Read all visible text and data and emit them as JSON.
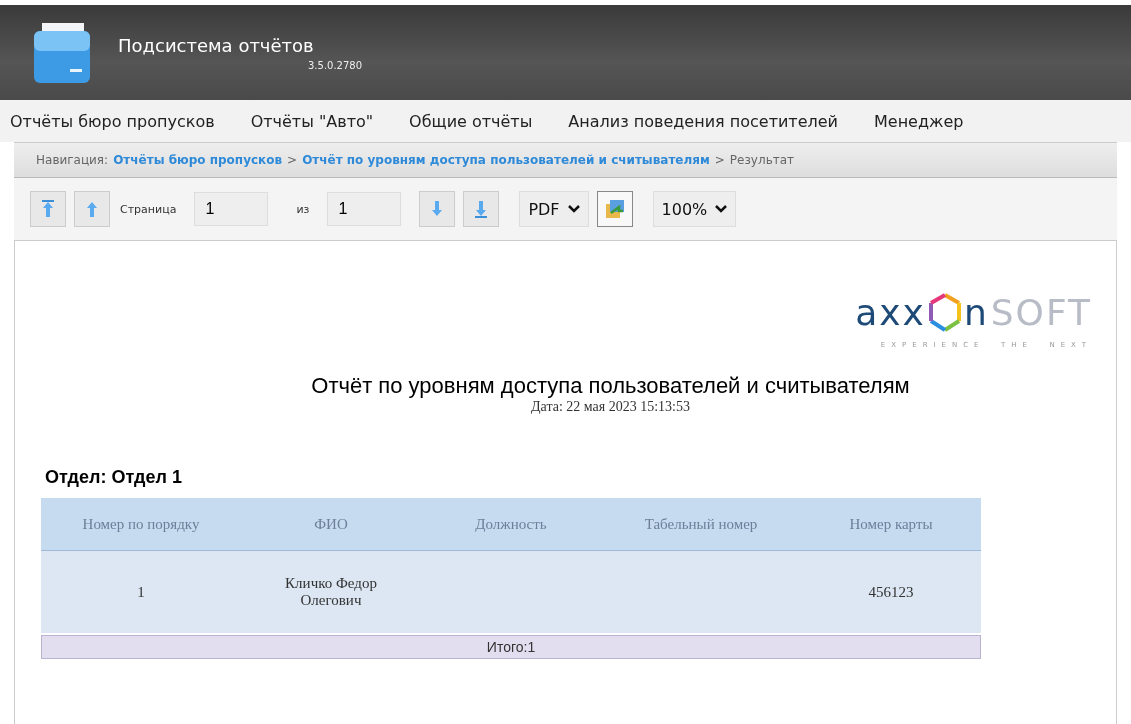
{
  "header": {
    "title": "Подсистема отчётов",
    "version": "3.5.0.2780"
  },
  "menu": [
    {
      "label": "Отчёты бюро пропусков"
    },
    {
      "label": "Отчёты \"Авто\""
    },
    {
      "label": "Общие отчёты"
    },
    {
      "label": "Анализ поведения посетителей"
    },
    {
      "label": "Менеджер"
    }
  ],
  "breadcrumb": {
    "label": "Навигация:",
    "links": [
      "Отчёты бюро пропусков",
      "Отчёт по уровням доступа пользователей и считывателям"
    ],
    "separator": ">",
    "current": "Результат"
  },
  "toolbar": {
    "page_label": "Страница",
    "page": "1",
    "of_label": "из",
    "total": "1",
    "format": "PDF",
    "zoom": "100%"
  },
  "report": {
    "logo": {
      "left": "axx",
      "right": "n",
      "brand": "SOFT",
      "tagline": "EXPERIENCE  THE  NEXT"
    },
    "title": "Отчёт по уровням доступа пользователей и считывателям",
    "date": "Дата: 22 мая 2023 15:13:53",
    "group": "Отдел: Отдел 1",
    "table": {
      "columns": [
        "Номер по порядку",
        "ФИО",
        "Должность",
        "Табельный номер",
        "Номер карты"
      ],
      "rows": [
        [
          "1",
          "Кличко Федор Олегович",
          "",
          "",
          "456123"
        ]
      ],
      "total": "Итого:1"
    }
  }
}
